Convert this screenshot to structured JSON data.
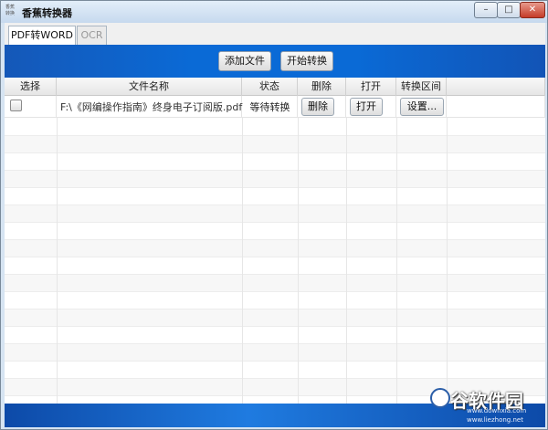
{
  "window": {
    "title": "香蕉转换器",
    "icon_text": "香蕉 转换",
    "controls": {
      "minimize": "–",
      "maximize": "□",
      "close": "✕"
    }
  },
  "tabs": [
    {
      "label": "PDF转WORD",
      "active": true
    },
    {
      "label": "OCR",
      "active": false
    }
  ],
  "toolbar": {
    "add_file": "添加文件",
    "start_convert": "开始转换"
  },
  "table": {
    "columns": [
      "选择",
      "文件名称",
      "状态",
      "删除",
      "打开",
      "转换区间"
    ],
    "rows": [
      {
        "checked": false,
        "filename": "F:\\《网编操作指南》终身电子订阅版.pdf",
        "status": "等待转换",
        "delete_label": "删除",
        "open_label": "打开",
        "range_label": "设置..."
      }
    ]
  },
  "watermark": {
    "brand": "谷软件园",
    "url1": "www.downxia.com",
    "url2": "www.liezhong.net"
  },
  "colors": {
    "banner_blue": "#0a6ad6",
    "titlebar": "#d6e4f2",
    "close_red": "#c53b28"
  }
}
